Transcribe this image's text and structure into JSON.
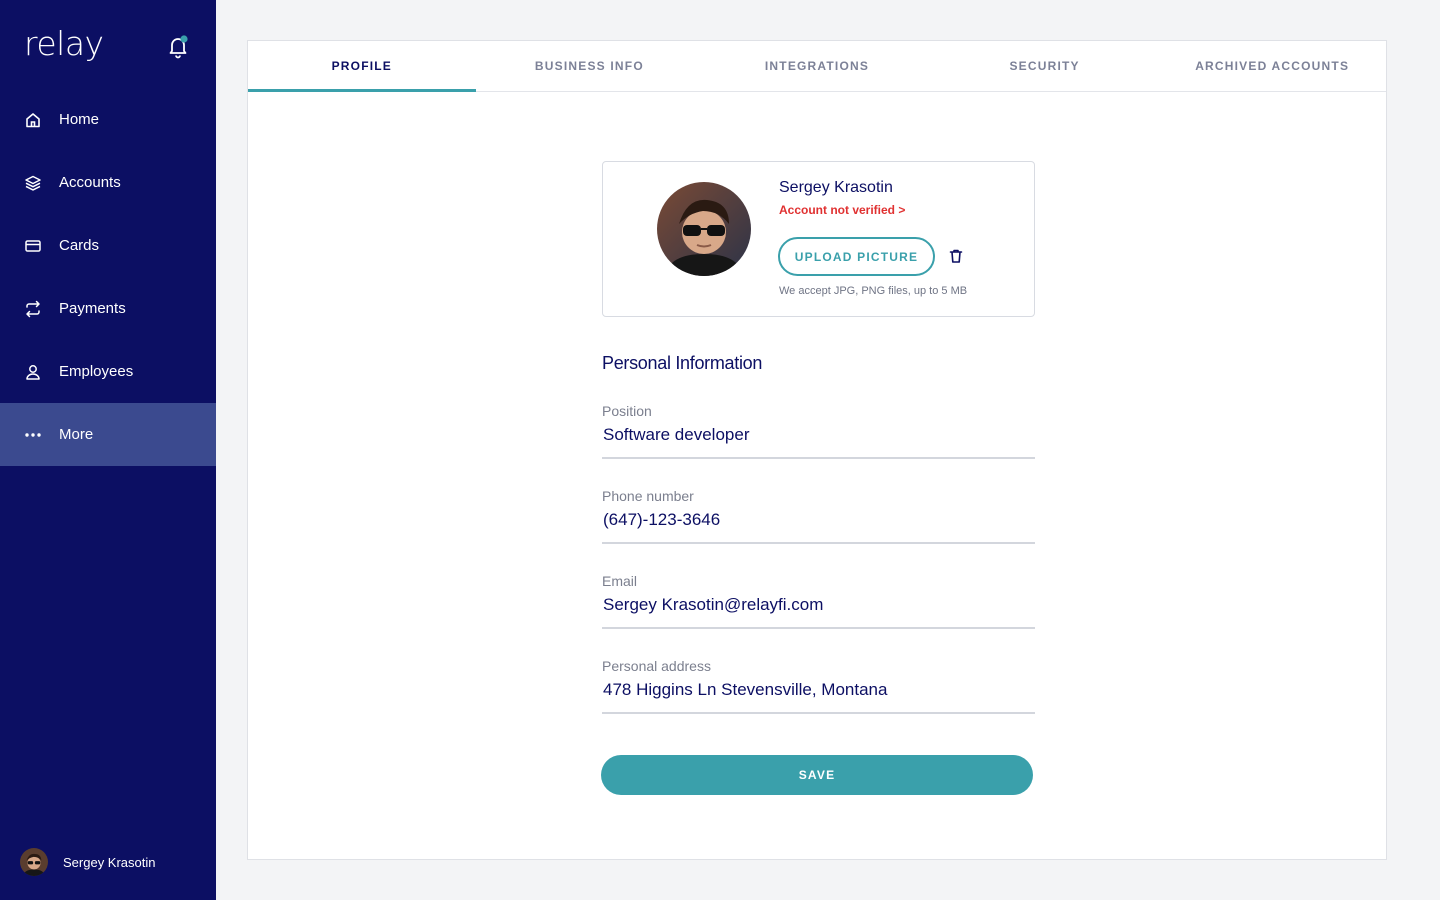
{
  "app": {
    "logo": "relay"
  },
  "colors": {
    "sidebar": "#0c0f63",
    "accent": "#3aa0ab",
    "error": "#e03131",
    "notification_dot": "#3aa0ab"
  },
  "sidebar": {
    "items": [
      {
        "label": "Home",
        "icon": "home-icon"
      },
      {
        "label": "Accounts",
        "icon": "layers-icon"
      },
      {
        "label": "Cards",
        "icon": "card-icon"
      },
      {
        "label": "Payments",
        "icon": "transfer-icon"
      },
      {
        "label": "Employees",
        "icon": "user-icon"
      },
      {
        "label": "More",
        "icon": "more-icon",
        "active": true
      }
    ],
    "user": {
      "name": "Sergey Krasotin"
    }
  },
  "tabs": [
    {
      "label": "PROFILE",
      "active": true
    },
    {
      "label": "BUSINESS INFO"
    },
    {
      "label": "INTEGRATIONS"
    },
    {
      "label": "SECURITY"
    },
    {
      "label": "ARCHIVED ACCOUNTS"
    }
  ],
  "profile": {
    "name": "Sergey Krasotin",
    "verification": "Account not verified >",
    "upload_label": "UPLOAD PICTURE",
    "hint": "We accept JPG, PNG files, up to 5 MB"
  },
  "personal": {
    "title": "Personal Information",
    "fields": [
      {
        "label": "Position",
        "value": "Software developer"
      },
      {
        "label": "Phone number",
        "value": "(647)-123-3646"
      },
      {
        "label": "Email",
        "value": "Sergey Krasotin@relayfi.com"
      },
      {
        "label": "Personal address",
        "value": "478 Higgins Ln Stevensville, Montana"
      }
    ]
  },
  "actions": {
    "save_label": "SAVE"
  }
}
